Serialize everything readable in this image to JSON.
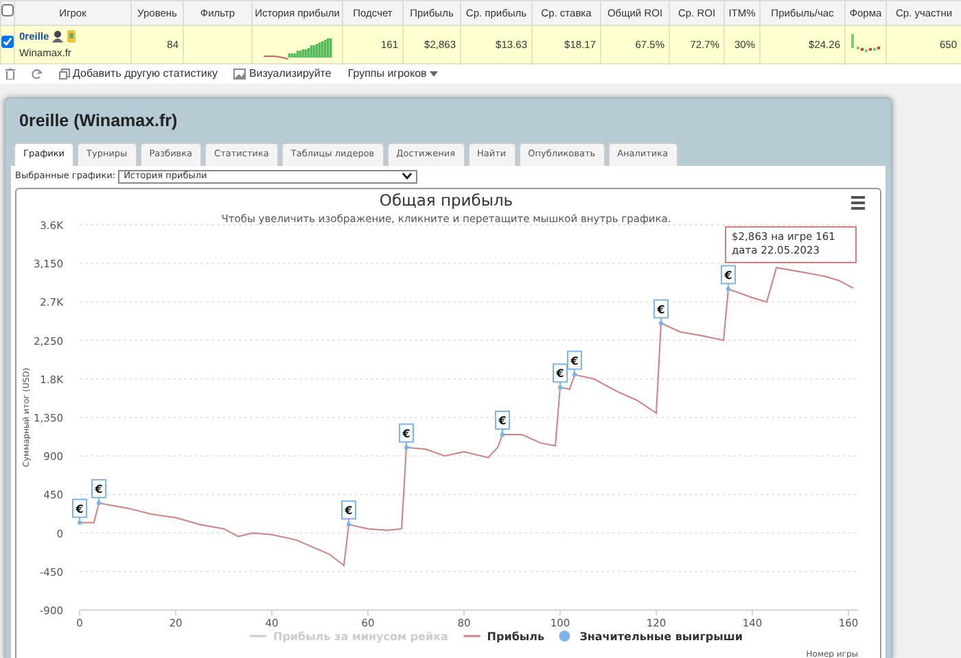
{
  "stats_table": {
    "columns": [
      "Игрок",
      "Уровень",
      "Фильтр",
      "История прибыли",
      "Подсчет",
      "Прибыль",
      "Ср. прибыль",
      "Ср. ставка",
      "Общий ROI",
      "Ср. ROI",
      "ITM%",
      "Прибыль/час",
      "Форма",
      "Ср. участни"
    ],
    "header_checked": false,
    "rows": [
      {
        "checked": true,
        "player": "0reille",
        "site": "Winamax.fr",
        "level": "84",
        "filter": "",
        "count": "161",
        "profit": "$2,863",
        "avg_profit": "$13.63",
        "avg_stake": "$18.17",
        "total_roi": "67.5%",
        "avg_roi": "72.7%",
        "itm": "30%",
        "profit_per_hour": "$24.26",
        "avg_entrants": "650"
      }
    ]
  },
  "toolbar": [
    {
      "kind": "trash"
    },
    {
      "kind": "refresh"
    },
    {
      "kind": "add",
      "label": "Добавить другую статистику"
    },
    {
      "kind": "chart",
      "label": "Визуализируйте"
    },
    {
      "kind": "dropdown",
      "label": "Группы игроков"
    }
  ],
  "panel": {
    "title": "0reille (Winamax.fr)",
    "tabs": [
      {
        "label": "Графики",
        "selected": true
      },
      {
        "label": "Турниры",
        "selected": false
      },
      {
        "label": "Разбивка",
        "selected": false
      },
      {
        "label": "Статистика",
        "selected": false
      },
      {
        "label": "Таблицы лидеров",
        "selected": false
      },
      {
        "label": "Достижения",
        "selected": false
      },
      {
        "label": "Найти",
        "selected": false
      },
      {
        "label": "Опубликовать",
        "selected": false
      },
      {
        "label": "Аналитика",
        "selected": false
      }
    ],
    "chart_select": {
      "label": "Выбранные графики:",
      "value": "История прибыли"
    },
    "chart": {
      "subtitle": "Чтобы увеличить изображение, кликните и перетащите мышкой внутрь графика.",
      "tooltip": "$2,863 на игре 161 дата 22.05.2023",
      "marker_symbol": "€",
      "hidden_legend": {
        "label": "Прибыль за минусом рейка",
        "visible": false
      },
      "chart_data": {
        "type": "line",
        "title": "Общая прибыль",
        "xlabel": "Номер игры",
        "ylabel": "Суммарный итог (USD)",
        "grid": true,
        "legend": true,
        "x": [
          0,
          3,
          4,
          6,
          10,
          15,
          20,
          25,
          30,
          33,
          36,
          40,
          45,
          50,
          52,
          55,
          56,
          60,
          64,
          67,
          68,
          72,
          76,
          80,
          85,
          87,
          88,
          92,
          96,
          99,
          100,
          102,
          103,
          107,
          112,
          116,
          120,
          121,
          125,
          130,
          134,
          135,
          140,
          143,
          145,
          150,
          155,
          158,
          161
        ],
        "series": [
          {
            "name": "Прибыль",
            "color": "#d08080",
            "values": [
              120,
              120,
              350,
              330,
              290,
              220,
              180,
              100,
              50,
              -40,
              0,
              -20,
              -80,
              -200,
              -250,
              -380,
              100,
              50,
              30,
              50,
              1000,
              980,
              900,
              950,
              880,
              1000,
              1150,
              1150,
              1050,
              1020,
              1700,
              1680,
              1850,
              1800,
              1650,
              1550,
              1400,
              2450,
              2350,
              2300,
              2250,
              2850,
              2750,
              2700,
              3100,
              3050,
              3000,
              2950,
              2860
            ]
          },
          {
            "name": "Значительные выигрыши",
            "color": "#7cb5ec",
            "marker": "circle",
            "values": [
              120,
              null,
              350,
              null,
              null,
              null,
              null,
              null,
              null,
              null,
              null,
              null,
              null,
              null,
              null,
              null,
              100,
              null,
              null,
              null,
              1000,
              null,
              null,
              null,
              null,
              null,
              1150,
              null,
              null,
              null,
              1700,
              null,
              1850,
              null,
              null,
              null,
              null,
              2450,
              null,
              null,
              null,
              2850,
              null,
              null,
              null,
              null,
              null,
              null,
              null
            ]
          }
        ],
        "xlim": [
          0,
          162
        ],
        "ylim": [
          -900,
          3600
        ],
        "xticks": [
          0,
          20,
          40,
          60,
          80,
          100,
          120,
          140,
          160
        ],
        "yticks": [
          {
            "value": -900,
            "label": "-900"
          },
          {
            "value": -450,
            "label": "-450"
          },
          {
            "value": 0,
            "label": "0"
          },
          {
            "value": 450,
            "label": "450"
          },
          {
            "value": 900,
            "label": "900"
          },
          {
            "value": 1350,
            "label": "1,350"
          },
          {
            "value": 1800,
            "label": "1.8K"
          },
          {
            "value": 2250,
            "label": "2,250"
          },
          {
            "value": 2700,
            "label": "2.7K"
          },
          {
            "value": 3150,
            "label": "3,150"
          },
          {
            "value": 3600,
            "label": "3.6K"
          }
        ]
      }
    }
  }
}
